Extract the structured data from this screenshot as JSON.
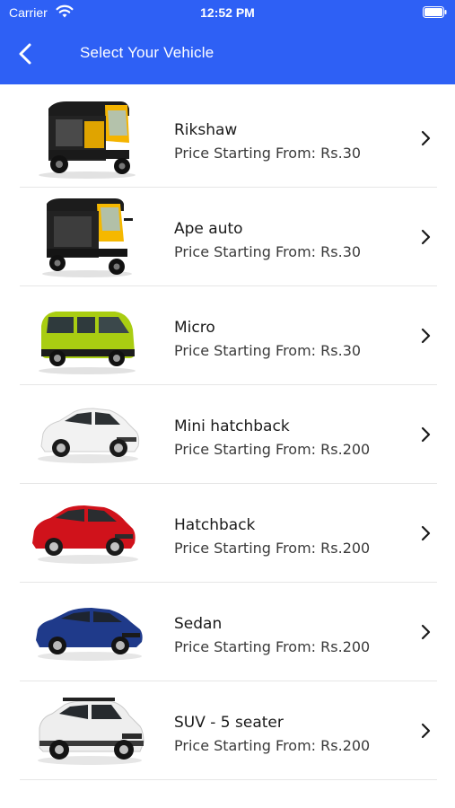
{
  "status_bar": {
    "carrier": "Carrier",
    "time": "12:52 PM"
  },
  "header": {
    "title": "Select Your Vehicle",
    "back_icon": "chevron-left-icon",
    "background": "#2e60f5"
  },
  "vehicles": [
    {
      "name": "Rikshaw",
      "price": "Price Starting From: Rs.30",
      "image": "auto-rickshaw-black-yellow"
    },
    {
      "name": "Ape auto",
      "price": "Price Starting From: Rs.30",
      "image": "ape-auto-black-yellow"
    },
    {
      "name": "Micro",
      "price": "Price Starting From: Rs.30",
      "image": "micro-car-lime-green"
    },
    {
      "name": "Mini hatchback",
      "price": "Price Starting From: Rs.200",
      "image": "hatchback-white"
    },
    {
      "name": "Hatchback",
      "price": "Price Starting From: Rs.200",
      "image": "hatchback-red"
    },
    {
      "name": "Sedan",
      "price": "Price Starting From: Rs.200",
      "image": "sedan-blue"
    },
    {
      "name": "SUV - 5 seater",
      "price": "Price Starting From: Rs.200",
      "image": "suv-white"
    }
  ]
}
